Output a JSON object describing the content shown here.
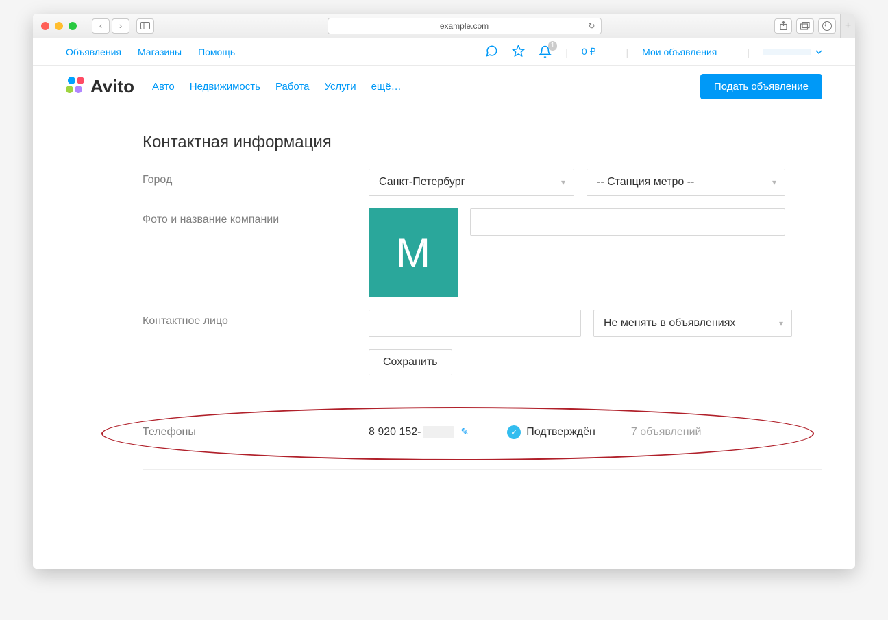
{
  "browser": {
    "url": "example.com"
  },
  "topNav": {
    "links": [
      "Объявления",
      "Магазины",
      "Помощь"
    ],
    "balance": "0 ₽",
    "myAds": "Мои объявления",
    "notificationCount": "1"
  },
  "logo": "Avito",
  "mainNav": [
    "Авто",
    "Недвижимость",
    "Работа",
    "Услуги",
    "ещё…"
  ],
  "postButton": "Подать объявление",
  "section": {
    "title": "Контактная информация",
    "cityLabel": "Город",
    "cityValue": "Санкт-Петербург",
    "metroPlaceholder": "-- Станция метро --",
    "companyLabel": "Фото и название компании",
    "avatarLetter": "М",
    "contactLabel": "Контактное лицо",
    "contactSelect": "Не менять в объявлениях",
    "saveLabel": "Сохранить"
  },
  "phones": {
    "label": "Телефоны",
    "number": "8 920 152-",
    "confirmed": "Подтверждён",
    "adsCount": "7 объявлений"
  }
}
